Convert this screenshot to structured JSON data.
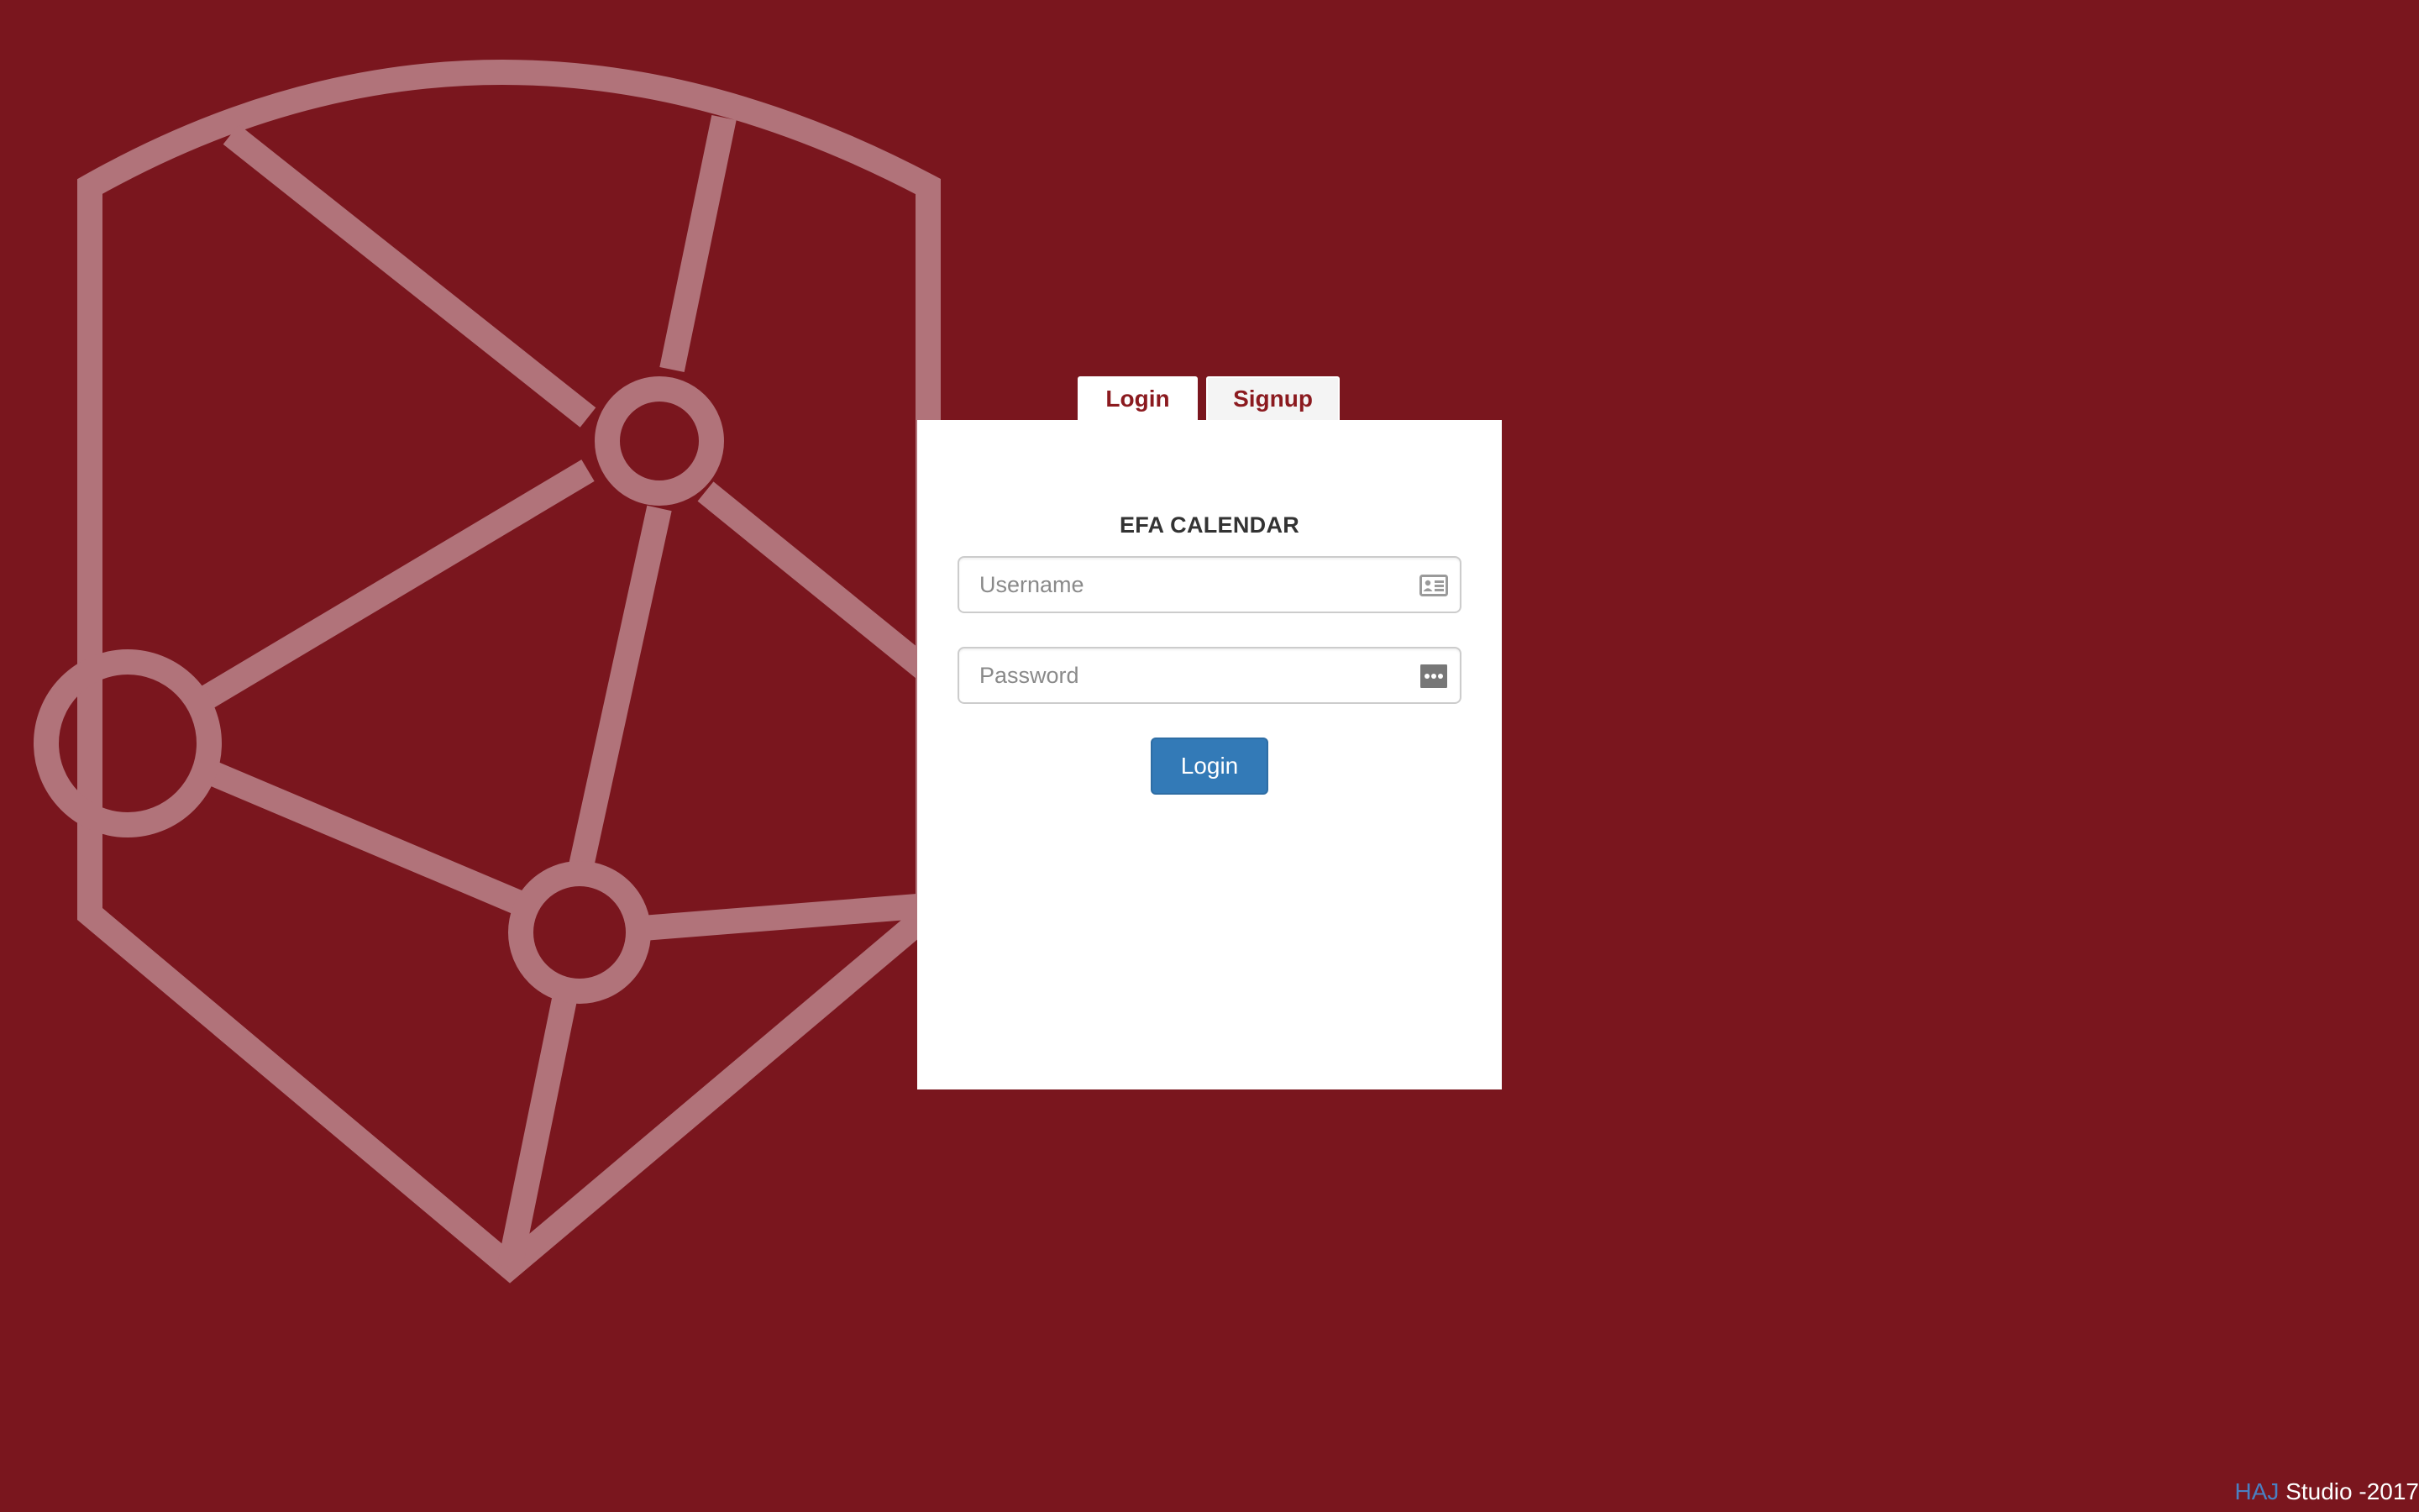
{
  "colors": {
    "background": "#7a161e",
    "logo_stroke": "#b1737a",
    "accent": "#8b1a1f",
    "primary_button": "#337ab7",
    "footer_brand": "#4a7fc1"
  },
  "tabs": [
    {
      "label": "Login",
      "active": true
    },
    {
      "label": "Signup",
      "active": false
    }
  ],
  "form": {
    "title": "EFA CALENDAR",
    "username": {
      "placeholder": "Username",
      "value": "",
      "icon": "id-card-icon"
    },
    "password": {
      "placeholder": "Password",
      "value": "",
      "icon": "password-dots-icon"
    },
    "submit_label": "Login"
  },
  "footer": {
    "brand": "HAJ",
    "text": " Studio -2017"
  }
}
